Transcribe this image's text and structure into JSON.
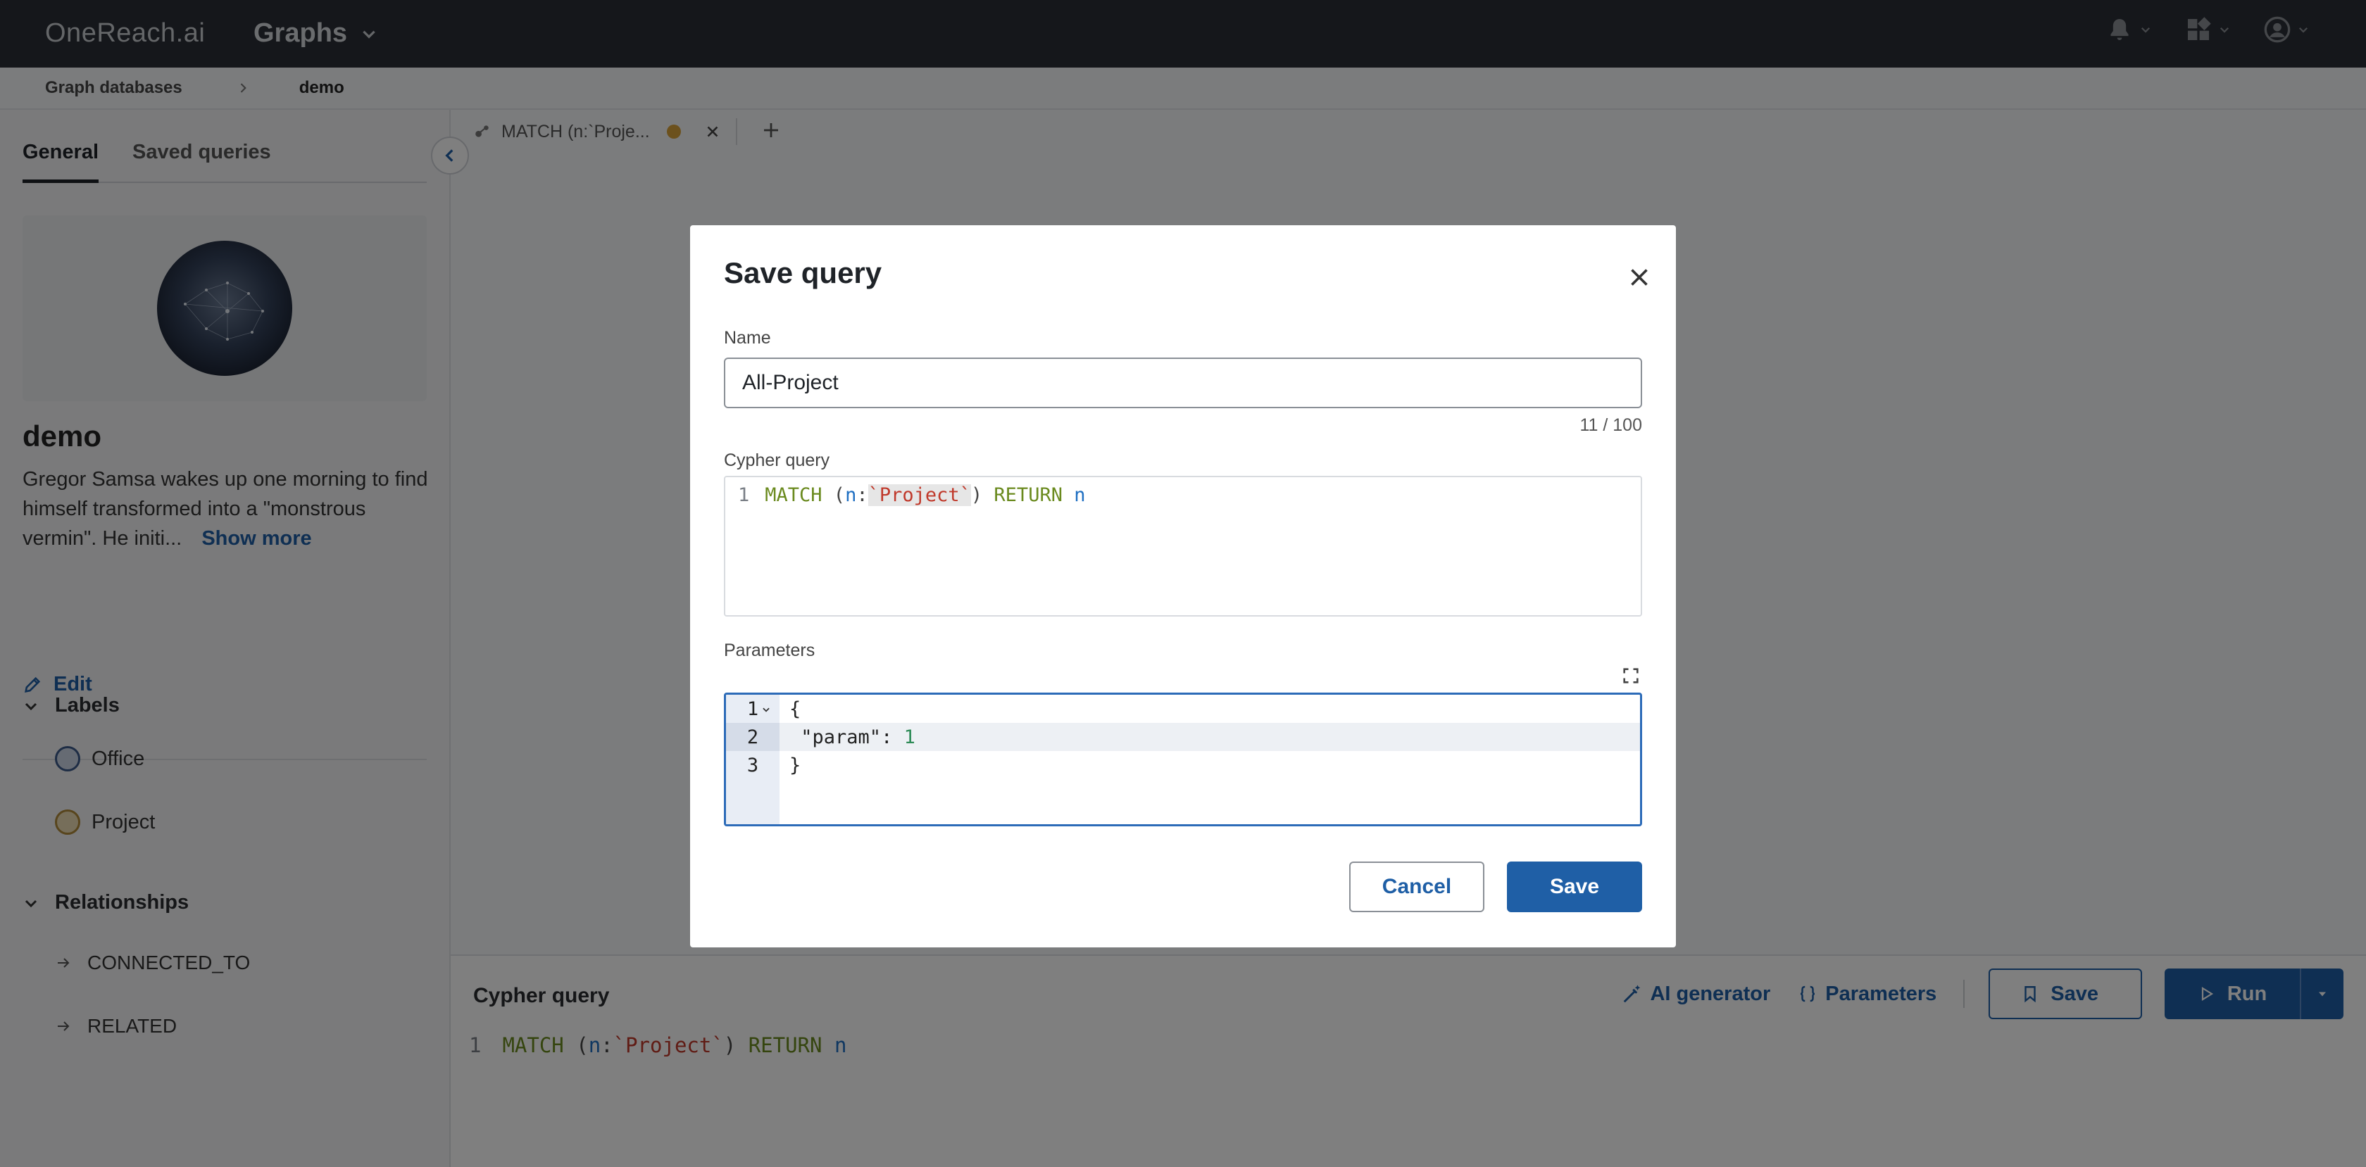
{
  "header": {
    "logo": "OneReach.ai",
    "app_title": "Graphs"
  },
  "breadcrumb": {
    "parent": "Graph databases",
    "current": "demo"
  },
  "sidebar": {
    "tabs": [
      "General",
      "Saved queries"
    ],
    "db_name": "demo",
    "description": "Gregor Samsa wakes up one morning to find himself transformed into a \"monstrous vermin\". He initi...",
    "show_more": "Show more",
    "edit": "Edit",
    "labels_title": "Labels",
    "labels": [
      {
        "name": "Office",
        "color": "#3d5a8a"
      },
      {
        "name": "Project",
        "color": "#b08a3a"
      }
    ],
    "relationships_title": "Relationships",
    "relationships": [
      "CONNECTED_TO",
      "RELATED"
    ]
  },
  "query_tab": {
    "title": "MATCH (n:`Proje..."
  },
  "cypher_panel": {
    "title": "Cypher query",
    "ai_generator": "AI generator",
    "parameters": "Parameters",
    "save": "Save",
    "run": "Run",
    "line_number": "1",
    "query": {
      "kw1": "MATCH",
      "open": " (",
      "var": "n",
      "colon": ":",
      "label": "`Project`",
      "close": ") ",
      "kw2": "RETURN",
      "sp": " ",
      "var2": "n"
    }
  },
  "modal": {
    "title": "Save query",
    "name_label": "Name",
    "name_value": "All-Project",
    "counter": "11 / 100",
    "cypher_label": "Cypher query",
    "cypher_line_number": "1",
    "params_label": "Parameters",
    "params_lines": [
      "1",
      "2",
      "3"
    ],
    "params_text": {
      "open": "{",
      "key": "\"param\"",
      "sep": ": ",
      "value": "1",
      "close": "}"
    },
    "cancel": "Cancel",
    "save": "Save"
  }
}
